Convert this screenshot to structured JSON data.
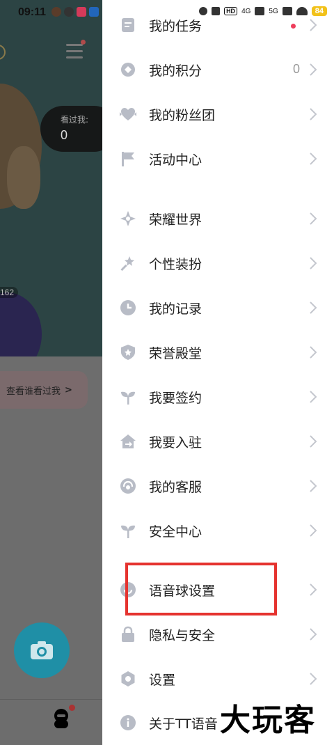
{
  "status_bar": {
    "time": "09:11",
    "network_hd": "HD",
    "signal_4g": "4G",
    "signal_5g": "5G",
    "battery": "84"
  },
  "background_page": {
    "viewed_label": "看过我:",
    "viewed_count": "0",
    "count_162": "162",
    "who_viewed_label": "查看谁看过我",
    "who_viewed_arrow": ">"
  },
  "drawer": {
    "items": [
      {
        "label": "我的任务",
        "icon": "task-icon"
      },
      {
        "label": "我的积分",
        "icon": "points-icon",
        "value": "0"
      },
      {
        "label": "我的粉丝团",
        "icon": "fans-heart-icon"
      },
      {
        "label": "活动中心",
        "icon": "flag-icon"
      },
      {
        "label": "荣耀世界",
        "icon": "glory-star-icon"
      },
      {
        "label": "个性装扮",
        "icon": "magic-wand-icon"
      },
      {
        "label": "我的记录",
        "icon": "clock-icon"
      },
      {
        "label": "荣誉殿堂",
        "icon": "shield-star-icon"
      },
      {
        "label": "我要签约",
        "icon": "sprout-icon"
      },
      {
        "label": "我要入驻",
        "icon": "house-arrow-icon"
      },
      {
        "label": "我的客服",
        "icon": "headset-icon"
      },
      {
        "label": "安全中心",
        "icon": "sprout-icon"
      },
      {
        "label": "语音球设置",
        "icon": "voice-ball-icon"
      },
      {
        "label": "隐私与安全",
        "icon": "lock-icon"
      },
      {
        "label": "设置",
        "icon": "gear-icon"
      },
      {
        "label": "关于TT语音",
        "icon": "info-icon"
      }
    ]
  },
  "watermark": "大玩客",
  "colors": {
    "icon_gray": "#b8bcc6",
    "highlight_red": "#e5332f",
    "notify_red": "#ee3d5b",
    "battery_yellow": "#f2c21b",
    "fab_teal": "#1f8fa6"
  }
}
